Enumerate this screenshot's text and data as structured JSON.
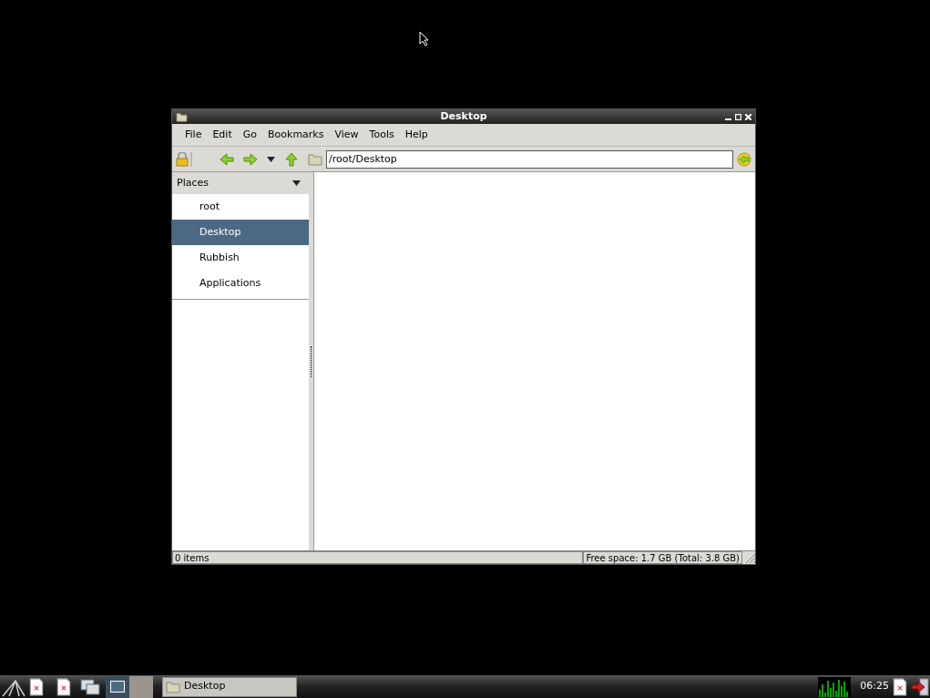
{
  "window": {
    "title": "Desktop"
  },
  "menu": [
    "File",
    "Edit",
    "Go",
    "Bookmarks",
    "View",
    "Tools",
    "Help"
  ],
  "location": {
    "value": "/root/Desktop"
  },
  "sidebar": {
    "title": "Places",
    "items": [
      {
        "label": "root",
        "selected": false
      },
      {
        "label": "Desktop",
        "selected": true
      },
      {
        "label": "Rubbish",
        "selected": false
      },
      {
        "label": "Applications",
        "selected": false
      }
    ]
  },
  "status_bar": {
    "items": "0 items",
    "free_space": "Free space: 1.7 GB (Total: 3.8 GB)"
  },
  "taskbar": {
    "task": "Desktop",
    "clock": "06:25"
  }
}
